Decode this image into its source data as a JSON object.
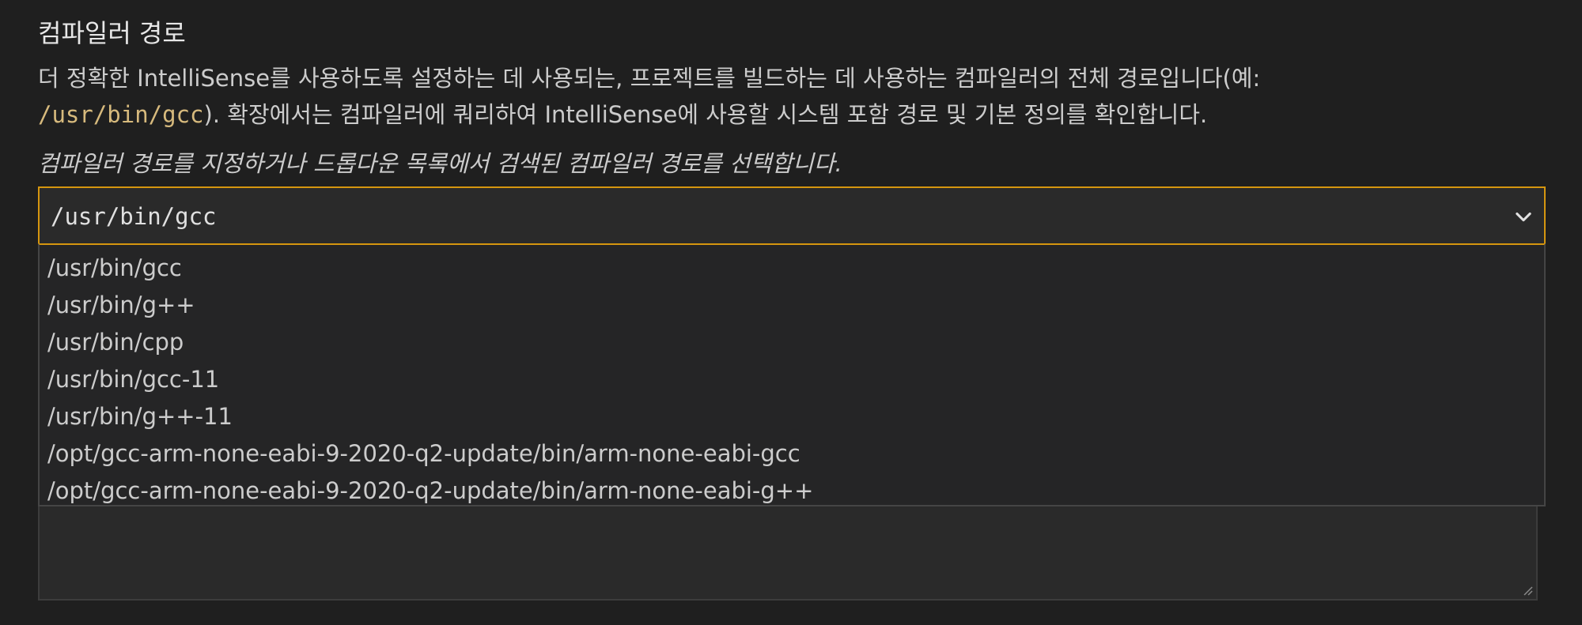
{
  "setting": {
    "title": "컴파일러 경로",
    "description_part1": "더 정확한 IntelliSense를 사용하도록 설정하는 데 사용되는, 프로젝트를 빌드하는 데 사용하는 컴파일러의 전체 경로입니다(예:",
    "description_code": "/usr/bin/gcc",
    "description_part2": "). 확장에서는 컴파일러에 쿼리하여 IntelliSense에 사용할 시스템 포함 경로 및 기본 정의를 확인합니다.",
    "hint": "컴파일러 경로를 지정하거나 드롭다운 목록에서 검색된 컴파일러 경로를 선택합니다."
  },
  "select": {
    "value": "/usr/bin/gcc",
    "icon": "chevron-down-icon",
    "options": [
      "/usr/bin/gcc",
      "/usr/bin/g++",
      "/usr/bin/cpp",
      "/usr/bin/gcc-11",
      "/usr/bin/g++-11",
      "/opt/gcc-arm-none-eabi-9-2020-q2-update/bin/arm-none-eabi-gcc",
      "/opt/gcc-arm-none-eabi-9-2020-q2-update/bin/arm-none-eabi-g++"
    ]
  },
  "colors": {
    "background": "#1f1f1f",
    "focus_border": "#d5960f",
    "code_text": "#d7ba7d",
    "dropdown_bg": "#252526"
  }
}
